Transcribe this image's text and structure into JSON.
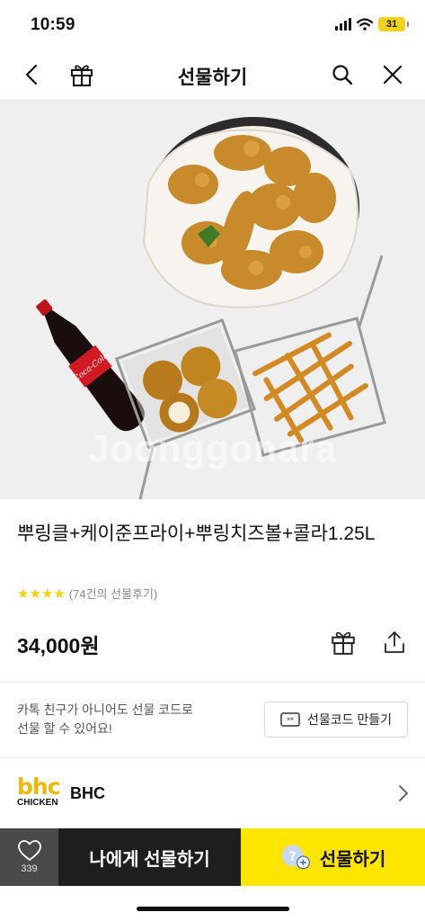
{
  "status_bar": {
    "time": "10:59",
    "battery": "31"
  },
  "nav": {
    "title": "선물하기"
  },
  "hero": {
    "watermark": "Joonggonara"
  },
  "product": {
    "name": "뿌링클+케이준프라이+뿌링치즈볼+콜라1.25L",
    "rating_stars": "★★★★",
    "review_count": "(74건의 선물후기)",
    "price": "34,000원"
  },
  "gift_code": {
    "description_line1": "카톡 친구가 아니어도 선물 코드로",
    "description_line2": "선물 할 수 있어요!",
    "button_label": "선물코드 만들기"
  },
  "brand": {
    "logo_top": "bhc",
    "logo_bottom": "CHICKEN",
    "name": "BHC"
  },
  "bottom_bar": {
    "like_count": "339",
    "gift_to_me_label": "나에게 선물하기",
    "gift_label": "선물하기"
  },
  "colors": {
    "kakao_yellow": "#fee500",
    "star_yellow": "#f5d10a",
    "brand_yellow": "#f2b705",
    "dark_button": "#1e1e1e"
  }
}
